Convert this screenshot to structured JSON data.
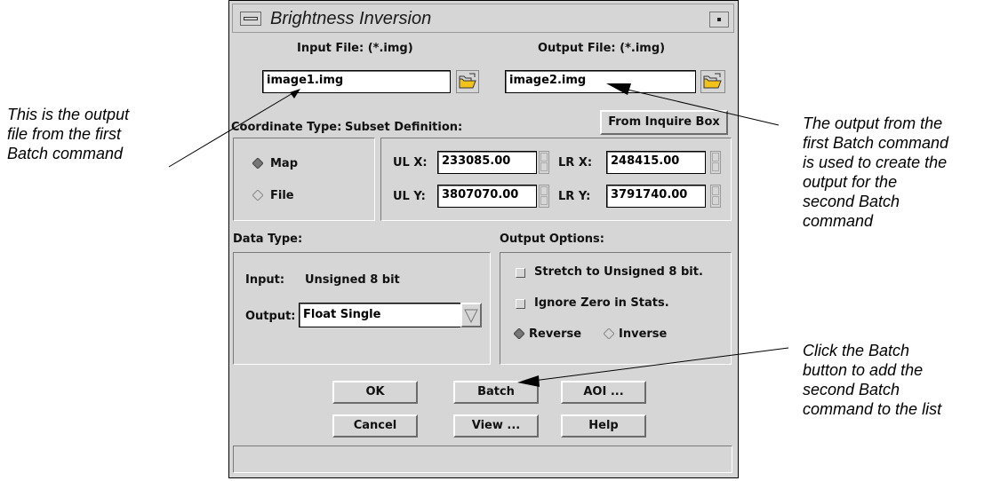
{
  "window": {
    "title": "Brightness Inversion"
  },
  "input_file": {
    "label": "Input File: (*.img)",
    "value": "image1.img"
  },
  "output_file": {
    "label": "Output File: (*.img)",
    "value": "image2.img"
  },
  "coordinate_type": {
    "label": "Coordinate Type:",
    "options": [
      "Map",
      "File"
    ],
    "selected": "Map"
  },
  "subset": {
    "label": "Subset Definition:",
    "inquire_button": "From Inquire Box",
    "ulx_label": "UL X:",
    "ulx": "233085.00",
    "uly_label": "UL Y:",
    "uly": "3807070.00",
    "lrx_label": "LR X:",
    "lrx": "248415.00",
    "lry_label": "LR Y:",
    "lry": "3791740.00"
  },
  "data_type": {
    "label": "Data Type:",
    "input_label": "Input:",
    "input_value": "Unsigned 8 bit",
    "output_label": "Output:",
    "output_value": "Float Single"
  },
  "output_options": {
    "label": "Output Options:",
    "stretch": "Stretch to Unsigned 8 bit.",
    "ignore_zero": "Ignore Zero in Stats.",
    "reverse": "Reverse",
    "inverse": "Inverse",
    "selected": "Reverse"
  },
  "buttons": {
    "ok": "OK",
    "batch": "Batch",
    "aoi": "AOI ...",
    "cancel": "Cancel",
    "view": "View ...",
    "help": "Help"
  },
  "annotations": {
    "left": [
      "This is the output",
      "file from the first",
      "Batch command"
    ],
    "right_top": [
      "The output from the",
      "first Batch command",
      "is used to create the",
      "output for the",
      "second Batch",
      "command"
    ],
    "right_bottom": [
      "Click the Batch",
      "button to add the",
      "second Batch",
      "command to the list"
    ]
  }
}
